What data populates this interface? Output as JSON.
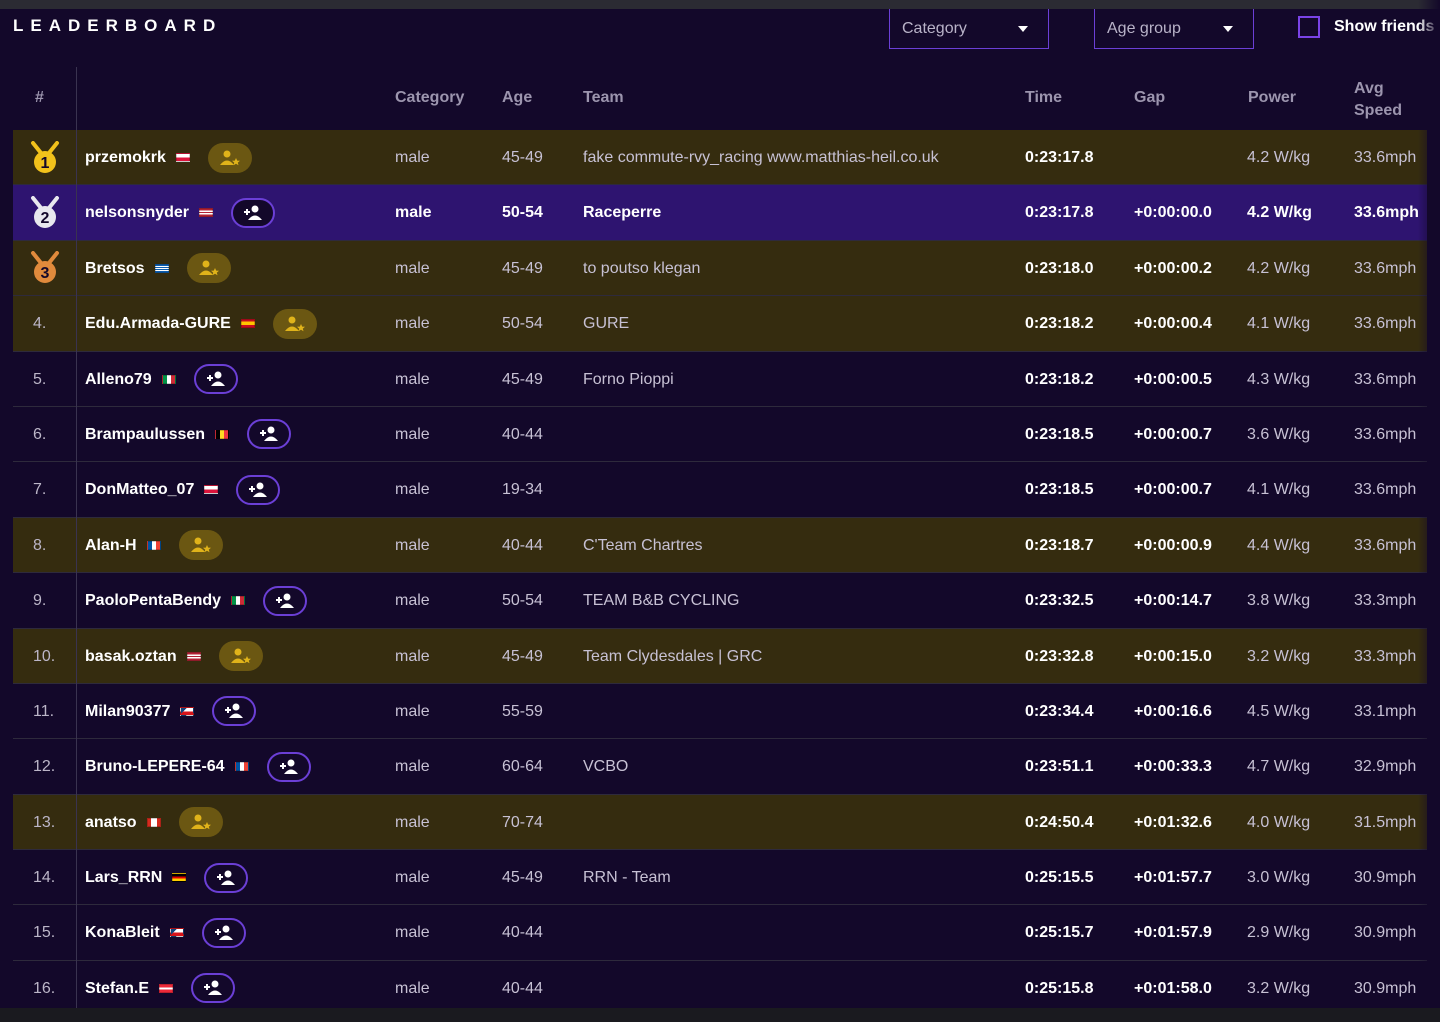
{
  "title": "LEADERBOARD",
  "filters": {
    "category_label": "Category",
    "age_group_label": "Age group",
    "show_friends_label": "Show friends"
  },
  "columns": {
    "rank": "#",
    "category": "Category",
    "age": "Age",
    "team": "Team",
    "time": "Time",
    "gap": "Gap",
    "power": "Power",
    "speed_line1": "Avg",
    "speed_line2": "Speed"
  },
  "rows": [
    {
      "rank": "1",
      "medal": "gold",
      "name": "przemokrk",
      "flag": "poland",
      "friend": true,
      "category": "male",
      "age": "45-49",
      "team": "fake commute-rvy_racing www.matthias-heil.co.uk",
      "time": "0:23:17.8",
      "gap": "",
      "power": "4.2 W/kg",
      "speed": "33.6mph"
    },
    {
      "rank": "2",
      "medal": "silver",
      "name": "nelsonsnyder",
      "flag": "usa",
      "friend": false,
      "selected": true,
      "category": "male",
      "age": "50-54",
      "team": "Raceperre",
      "time": "0:23:17.8",
      "gap": "+0:00:00.0",
      "power": "4.2 W/kg",
      "speed": "33.6mph"
    },
    {
      "rank": "3",
      "medal": "bronze",
      "name": "Bretsos",
      "flag": "greece",
      "friend": true,
      "category": "male",
      "age": "45-49",
      "team": "to poutso klegan",
      "time": "0:23:18.0",
      "gap": "+0:00:00.2",
      "power": "4.2 W/kg",
      "speed": "33.6mph"
    },
    {
      "rank": "4.",
      "name": "Edu.Armada-GURE",
      "flag": "spain",
      "friend": true,
      "category": "male",
      "age": "50-54",
      "team": "GURE",
      "time": "0:23:18.2",
      "gap": "+0:00:00.4",
      "power": "4.1 W/kg",
      "speed": "33.6mph"
    },
    {
      "rank": "5.",
      "name": "Alleno79",
      "flag": "italy",
      "friend": false,
      "category": "male",
      "age": "45-49",
      "team": "Forno Pioppi",
      "time": "0:23:18.2",
      "gap": "+0:00:00.5",
      "power": "4.3 W/kg",
      "speed": "33.6mph"
    },
    {
      "rank": "6.",
      "name": "Brampaulussen",
      "flag": "belgium",
      "friend": false,
      "category": "male",
      "age": "40-44",
      "team": "",
      "time": "0:23:18.5",
      "gap": "+0:00:00.7",
      "power": "3.6 W/kg",
      "speed": "33.6mph"
    },
    {
      "rank": "7.",
      "name": "DonMatteo_07",
      "flag": "poland",
      "friend": false,
      "category": "male",
      "age": "19-34",
      "team": "",
      "time": "0:23:18.5",
      "gap": "+0:00:00.7",
      "power": "4.1 W/kg",
      "speed": "33.6mph"
    },
    {
      "rank": "8.",
      "name": "Alan-H",
      "flag": "france",
      "friend": true,
      "category": "male",
      "age": "40-44",
      "team": "C'Team Chartres",
      "time": "0:23:18.7",
      "gap": "+0:00:00.9",
      "power": "4.4 W/kg",
      "speed": "33.6mph"
    },
    {
      "rank": "9.",
      "name": "PaoloPentaBendy",
      "flag": "italy",
      "friend": false,
      "category": "male",
      "age": "50-54",
      "team": "TEAM B&B CYCLING",
      "time": "0:23:32.5",
      "gap": "+0:00:14.7",
      "power": "3.8 W/kg",
      "speed": "33.3mph"
    },
    {
      "rank": "10.",
      "name": "basak.oztan",
      "flag": "usa",
      "friend": true,
      "category": "male",
      "age": "45-49",
      "team": "Team Clydesdales | GRC",
      "time": "0:23:32.8",
      "gap": "+0:00:15.0",
      "power": "3.2 W/kg",
      "speed": "33.3mph"
    },
    {
      "rank": "11.",
      "name": "Milan90377",
      "flag": "czech",
      "friend": false,
      "category": "male",
      "age": "55-59",
      "team": "",
      "time": "0:23:34.4",
      "gap": "+0:00:16.6",
      "power": "4.5 W/kg",
      "speed": "33.1mph"
    },
    {
      "rank": "12.",
      "name": "Bruno-LEPERE-64",
      "flag": "france",
      "friend": false,
      "category": "male",
      "age": "60-64",
      "team": "VCBO",
      "time": "0:23:51.1",
      "gap": "+0:00:33.3",
      "power": "4.7 W/kg",
      "speed": "32.9mph"
    },
    {
      "rank": "13.",
      "name": "anatso",
      "flag": "canada",
      "friend": true,
      "category": "male",
      "age": "70-74",
      "team": "",
      "time": "0:24:50.4",
      "gap": "+0:01:32.6",
      "power": "4.0 W/kg",
      "speed": "31.5mph"
    },
    {
      "rank": "14.",
      "name": "Lars_RRN",
      "flag": "germany",
      "friend": false,
      "category": "male",
      "age": "45-49",
      "team": "RRN - Team",
      "time": "0:25:15.5",
      "gap": "+0:01:57.7",
      "power": "3.0 W/kg",
      "speed": "30.9mph"
    },
    {
      "rank": "15.",
      "name": "KonaBleit",
      "flag": "czech",
      "friend": false,
      "category": "male",
      "age": "40-44",
      "team": "",
      "time": "0:25:15.7",
      "gap": "+0:01:57.9",
      "power": "2.9 W/kg",
      "speed": "30.9mph"
    },
    {
      "rank": "16.",
      "name": "Stefan.E",
      "flag": "austria",
      "friend": false,
      "category": "male",
      "age": "40-44",
      "team": "",
      "time": "0:25:15.8",
      "gap": "+0:01:58.0",
      "power": "3.2 W/kg",
      "speed": "30.9mph"
    }
  ],
  "colors": {
    "background": "#13082a",
    "friend_row": "#352c0f",
    "selected_row": "#2e1470",
    "accent_purple": "#6b3fd6",
    "gold": "#e0b31a"
  }
}
